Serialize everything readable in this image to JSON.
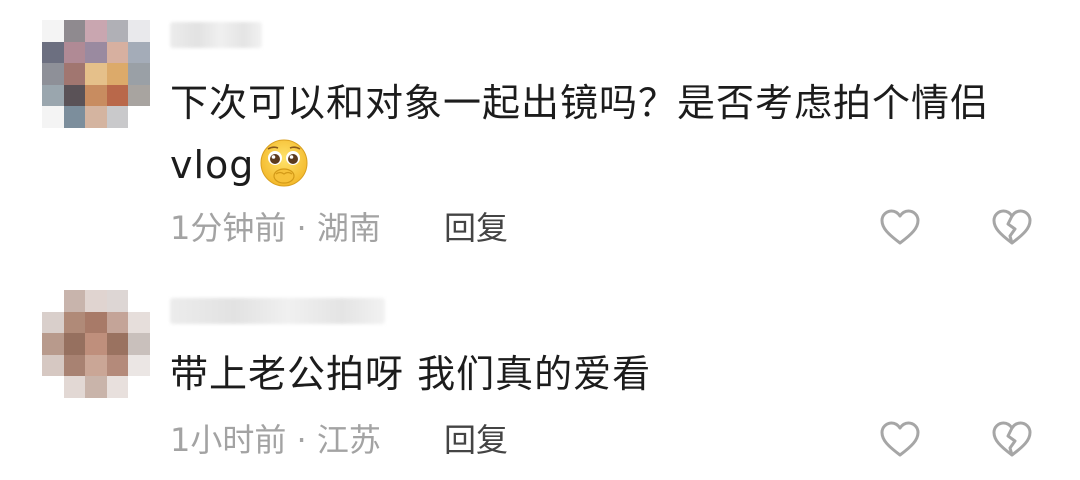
{
  "comments": [
    {
      "text": "下次可以和对象一起出镜吗？是否考虑拍个情侣vlog",
      "emoji": "pleading-face-emoji",
      "meta": "1分钟前 · 湖南",
      "reply_label": "回复"
    },
    {
      "text": "带上老公拍呀 我们真的爱看",
      "meta": "1小时前 · 江苏",
      "reply_label": "回复"
    }
  ],
  "icons": {
    "like": "heart-outline-icon",
    "dislike": "broken-heart-icon"
  },
  "colors": {
    "text": "#1c1c1c",
    "meta": "#a3a3a3",
    "reply": "#444444",
    "icon": "#a6a6a6"
  }
}
